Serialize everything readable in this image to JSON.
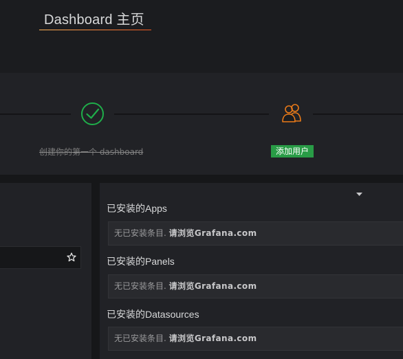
{
  "header": {
    "title": "Dashboard 主页"
  },
  "progress": {
    "steps": [
      {
        "label": "创建你的第一个 dashboard",
        "status": "done",
        "icon": "check-circle-icon"
      },
      {
        "label": "添加用户",
        "status": "active",
        "icon": "users-icon"
      }
    ]
  },
  "plugins": {
    "sections": [
      {
        "heading": "已安装的Apps",
        "empty_text": "无已安装条目. ",
        "link_text": "请浏览Grafana.com"
      },
      {
        "heading": "已安装的Panels",
        "empty_text": "无已安装条目. ",
        "link_text": "请浏览Grafana.com"
      },
      {
        "heading": "已安装的Datasources",
        "empty_text": "无已安装条目. ",
        "link_text": "请浏览Grafana.com"
      }
    ]
  },
  "colors": {
    "accent": "#eb7b18",
    "success": "#299c46",
    "check": "#1fae4a"
  },
  "icons": [
    "check-circle-icon",
    "users-icon",
    "star-icon",
    "caret-down-icon"
  ]
}
